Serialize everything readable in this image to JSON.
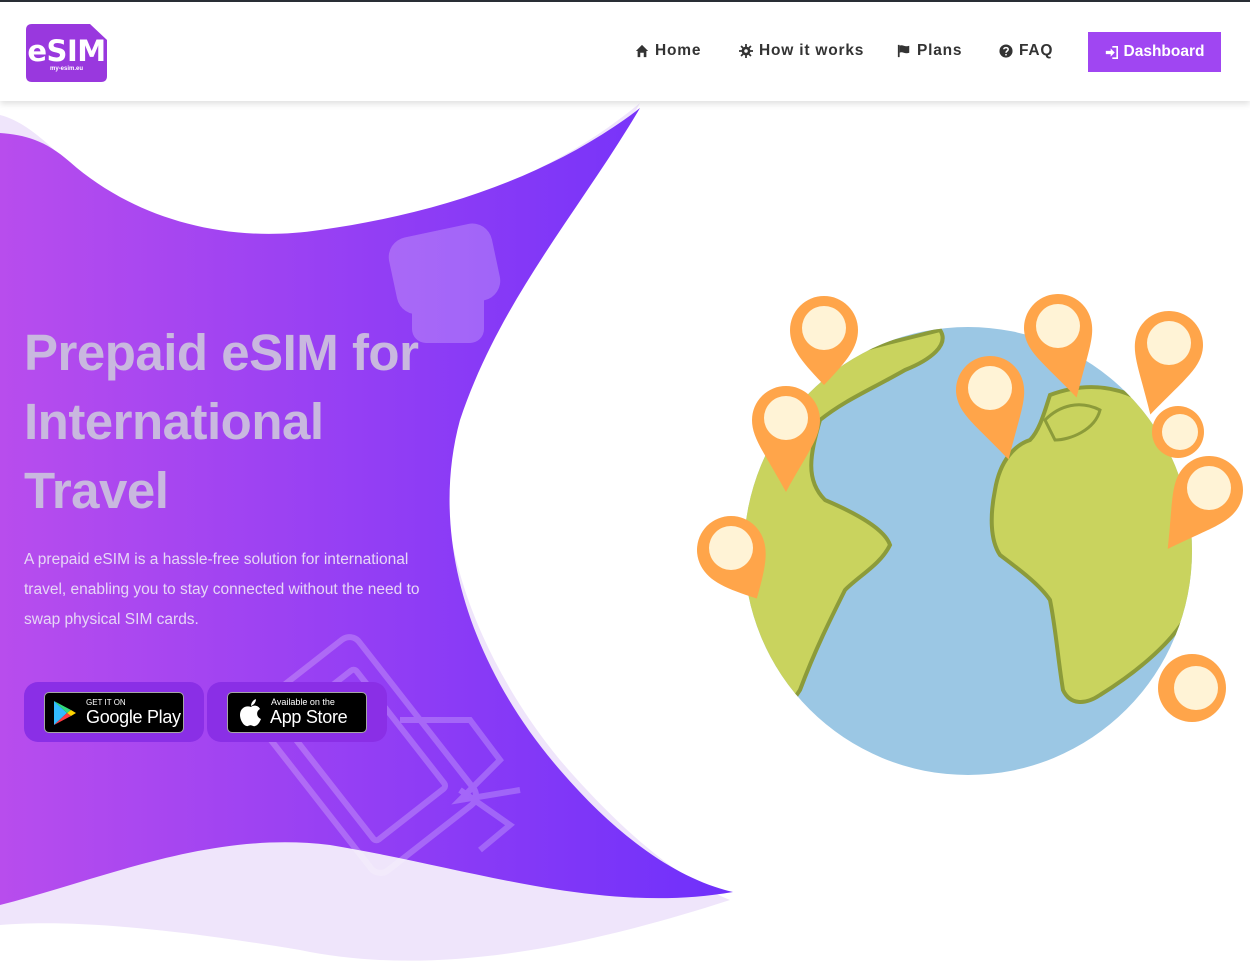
{
  "header": {
    "logo": {
      "brand": "eSIM",
      "domain": "my-esim.eu"
    },
    "nav": [
      {
        "label": "Home",
        "icon": "home-icon"
      },
      {
        "label": "How it works",
        "icon": "gear-icon"
      },
      {
        "label": "Plans",
        "icon": "flag-icon"
      },
      {
        "label": "FAQ",
        "icon": "question-circle-icon"
      }
    ],
    "dashboard": {
      "label": "Dashboard",
      "icon": "sign-in-icon"
    }
  },
  "hero": {
    "title_lines": [
      "Prepaid eSIM for",
      "International",
      "Travel"
    ],
    "description": "A prepaid eSIM is a hassle-free solution for international travel, enabling you to stay connected without the need to swap physical SIM cards.",
    "google_play": {
      "small": "GET IT ON",
      "big": "Google Play"
    },
    "app_store": {
      "small": "Available on the",
      "big": "App Store"
    }
  },
  "colors": {
    "accent": "#a046f2",
    "gradient_start": "#b84ded",
    "gradient_end": "#6f30fb",
    "globe_ocean": "#9bc7e4",
    "land": "#c9d35e",
    "pin": "#ffa54a"
  }
}
